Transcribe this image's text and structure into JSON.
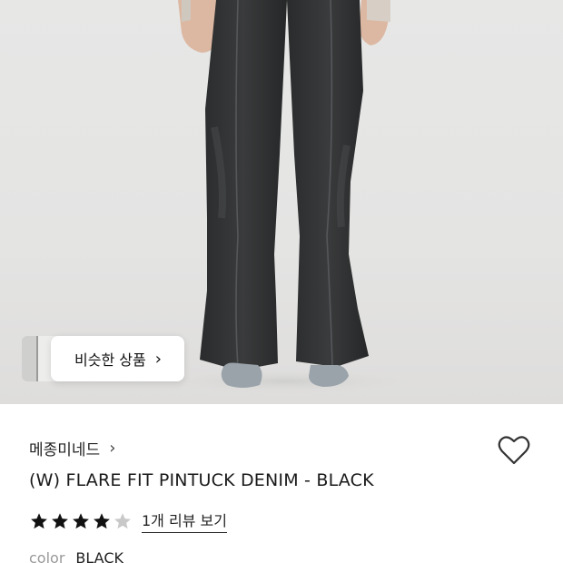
{
  "hero": {
    "similar_button": {
      "label": "비슷한 상품",
      "chevron": "chevron-right-icon"
    }
  },
  "product": {
    "brand": "메종미네드",
    "brand_chevron": "chevron-right-icon",
    "title": "(W) FLARE FIT PINTUCK DENIM - BLACK",
    "wishlist_icon": "heart-outline-icon",
    "rating": {
      "value": 4,
      "max": 5
    },
    "review_link": "1개 리뷰 보기",
    "color_label": "color",
    "color_value": "BLACK"
  },
  "colors": {
    "star_filled": "#111111",
    "star_empty": "#c8c8c8",
    "hero_bg": "#e5e5e4"
  }
}
